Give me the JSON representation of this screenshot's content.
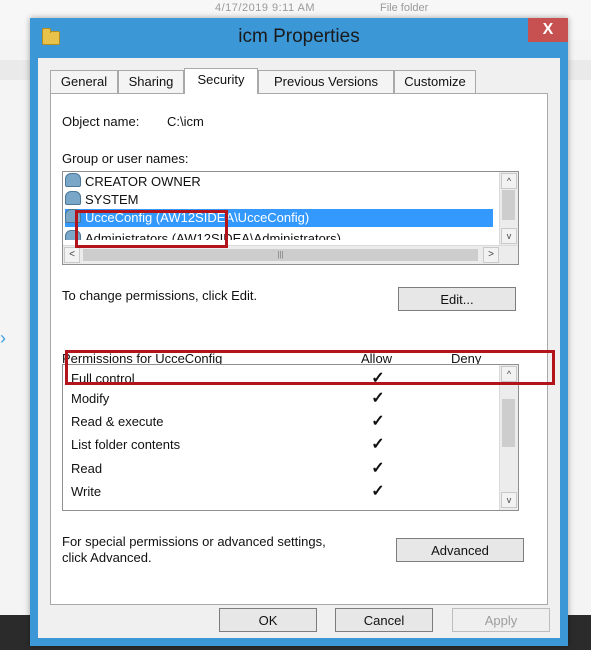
{
  "window": {
    "title": "icm Properties",
    "close_label": "X"
  },
  "background": {
    "timestamp_text": "4/17/2019 9:11 AM",
    "type_text": "File folder",
    "side_arrow": "›"
  },
  "tabs": [
    {
      "label": "General"
    },
    {
      "label": "Sharing"
    },
    {
      "label": "Security"
    },
    {
      "label": "Previous Versions"
    },
    {
      "label": "Customize"
    }
  ],
  "security": {
    "object_name_label": "Object name:",
    "object_name_value": "C:\\icm",
    "group_label": "Group or user names:",
    "users": [
      {
        "name": "CREATOR OWNER"
      },
      {
        "name": "SYSTEM"
      },
      {
        "name": "UcceConfig (AW12SIDEA\\UcceConfig)"
      },
      {
        "name": "Administrators (AW12SIDEA\\Administrators)"
      }
    ],
    "scroll_up": "^",
    "scroll_down": "v",
    "scroll_left": "<",
    "scroll_right": ">",
    "scroll_grip": "|||",
    "change_text": "To change permissions, click Edit.",
    "edit_button": "Edit...",
    "perm_header": "Permissions for UcceConfig",
    "allow_header": "Allow",
    "deny_header": "Deny",
    "permissions": [
      {
        "name": "Full control",
        "allow": "✓"
      },
      {
        "name": "Modify",
        "allow": "✓"
      },
      {
        "name": "Read & execute",
        "allow": "✓"
      },
      {
        "name": "List folder contents",
        "allow": "✓"
      },
      {
        "name": "Read",
        "allow": "✓"
      },
      {
        "name": "Write",
        "allow": "✓"
      }
    ],
    "special_text_1": "For special permissions or advanced settings,",
    "special_text_2": "click Advanced.",
    "advanced_button": "Advanced"
  },
  "footer": {
    "ok_button": "OK",
    "cancel_button": "Cancel",
    "apply_button": "Apply"
  },
  "colors": {
    "window_frame": "#3c97d6",
    "highlight_box": "#b3131b",
    "selection": "#3399ff"
  }
}
